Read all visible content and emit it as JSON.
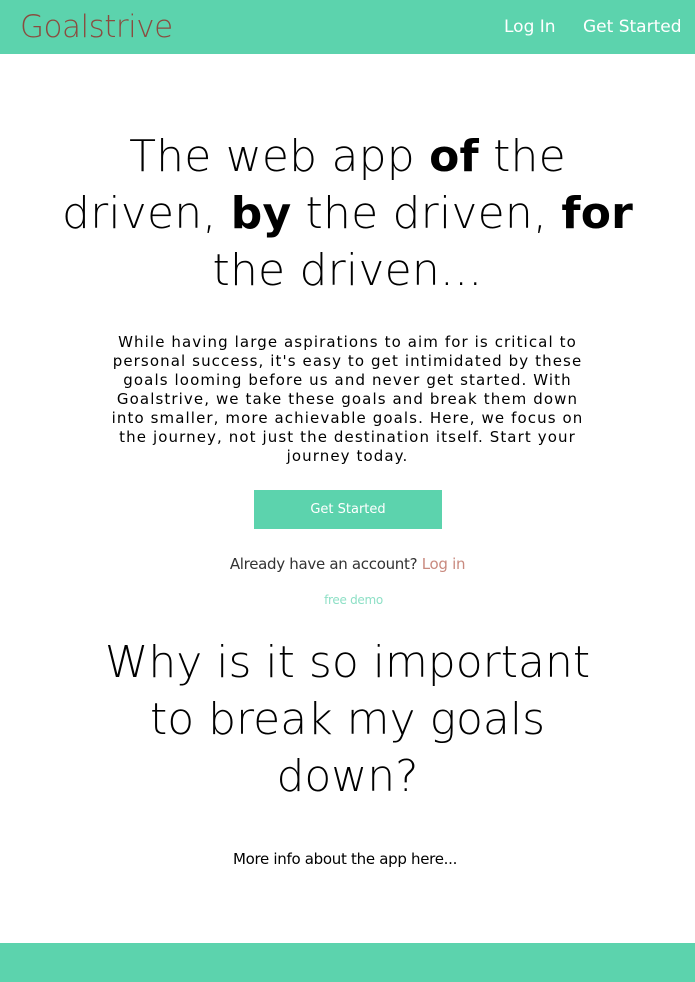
{
  "nav": {
    "brand": "Goalstrive",
    "login_label": "Log In",
    "get_started_label": "Get Started"
  },
  "hero": {
    "title_parts": {
      "p1": "The web app ",
      "b1": "of",
      "p2": " the driven, ",
      "b2": "by",
      "p3": " the driven, ",
      "b3": "for",
      "p4": " the driven..."
    },
    "description": "While having large aspirations to aim for is critical to personal success, it's easy to get intimidated by these goals looming before us and never get started. With Goalstrive, we take these goals and break them down into smaller, more achievable goals. Here, we focus on the journey, not just the destination itself. Start your journey today.",
    "cta_label": "Get Started",
    "account_prompt": "Already have an account? ",
    "account_link": "Log in",
    "demo_link": "free demo"
  },
  "section": {
    "title": "Why is it so important to break my goals down?",
    "more_info": "More info about the app here..."
  },
  "colors": {
    "accent": "#5cd3ad",
    "brand_text": "#8b4b3f",
    "login_link": "#c98a7f",
    "demo_link": "#8ee0c6"
  }
}
